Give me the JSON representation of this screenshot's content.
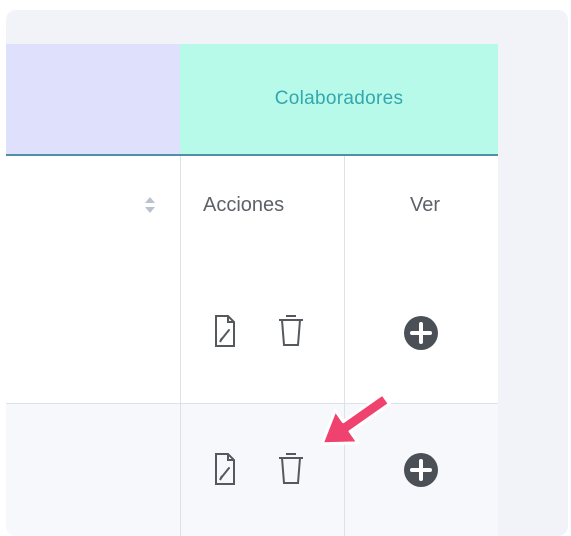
{
  "header": {
    "group_colab": "Colaboradores",
    "col_acciones": "Acciones",
    "col_ver": "Ver"
  },
  "rows": [
    {
      "actions": [
        "edit-document-icon",
        "delete-trash-icon"
      ],
      "view": "plus-circle-icon"
    },
    {
      "actions": [
        "edit-document-icon",
        "delete-trash-icon"
      ],
      "view": "plus-circle-icon"
    }
  ],
  "colors": {
    "group_left_bg": "#dfe0fb",
    "group_colab_bg": "#b8fae9",
    "group_colab_text": "#34a7ae",
    "icon_dark": "#4a5056",
    "cursor_pink": "#f0426e"
  }
}
